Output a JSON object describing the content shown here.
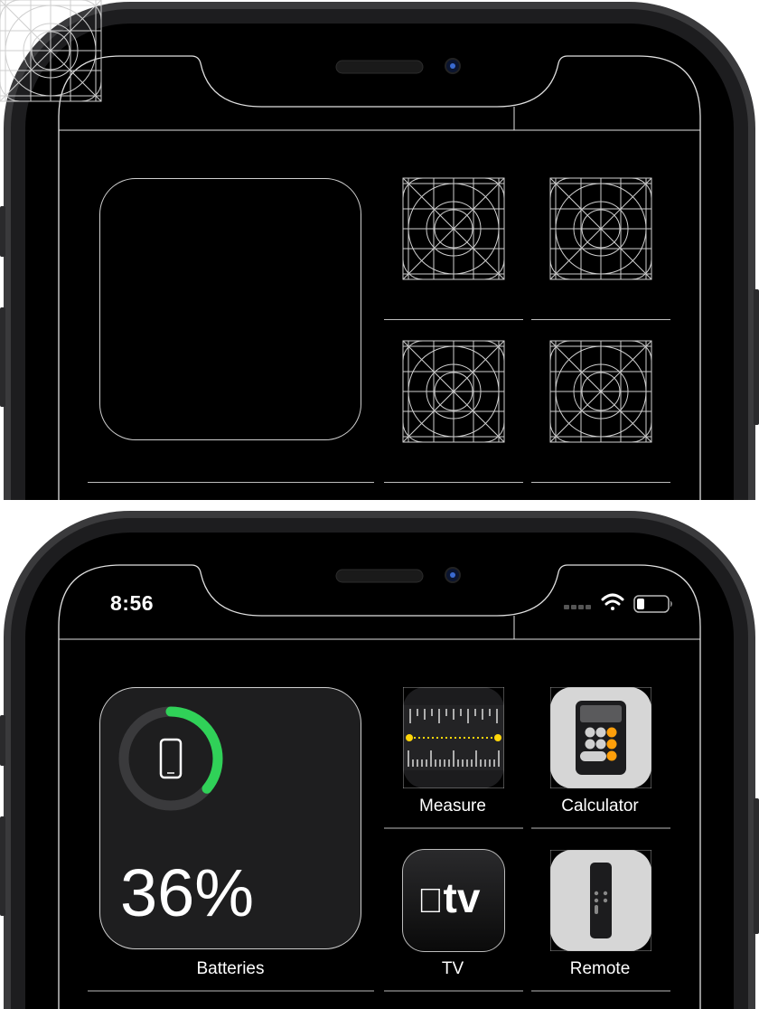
{
  "status_bar": {
    "time": "8:56",
    "battery_level": 0.25,
    "wifi": "wifi-icon",
    "cellular": "no-signal-dots"
  },
  "widget": {
    "name": "Batteries",
    "percent_text": "36%",
    "percent": 36,
    "device_icon": "iphone-icon",
    "ring_color": "#30d158"
  },
  "apps": [
    {
      "name": "Measure",
      "icon": "measure-icon"
    },
    {
      "name": "Calculator",
      "icon": "calculator-icon"
    },
    {
      "name": "TV",
      "icon": "apple-tv-icon",
      "icon_text": "tv"
    },
    {
      "name": "Remote",
      "icon": "remote-icon"
    }
  ],
  "colors": {
    "accent_orange": "#ff9f0a",
    "measure_yellow": "#ffd60a",
    "green": "#30d158"
  }
}
